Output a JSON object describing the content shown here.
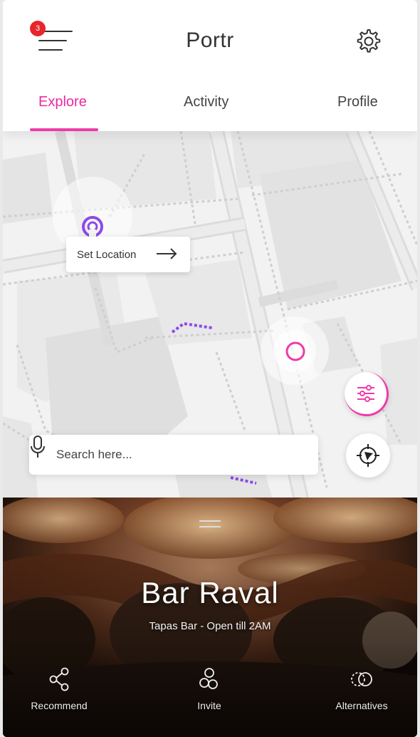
{
  "header": {
    "title": "Portr",
    "notification_count": "3",
    "menu_icon": "hamburger-menu-icon",
    "settings_icon": "gear-icon"
  },
  "tabs": [
    {
      "label": "Explore",
      "active": true
    },
    {
      "label": "Activity",
      "active": false
    },
    {
      "label": "Profile",
      "active": false
    }
  ],
  "map": {
    "set_location_label": "Set Location",
    "search_placeholder": "Search here...",
    "search_value": ""
  },
  "venue": {
    "name": "Bar Raval",
    "subtitle": "Tapas Bar - Open till 2AM"
  },
  "actions": [
    {
      "label": "Recommend",
      "icon": "share-icon"
    },
    {
      "label": "Invite",
      "icon": "group-icon"
    },
    {
      "label": "Alternatives",
      "icon": "alternatives-icon"
    }
  ],
  "colors": {
    "accent": "#e92aa3",
    "badge": "#e8252b",
    "route": "#8b4be8"
  }
}
